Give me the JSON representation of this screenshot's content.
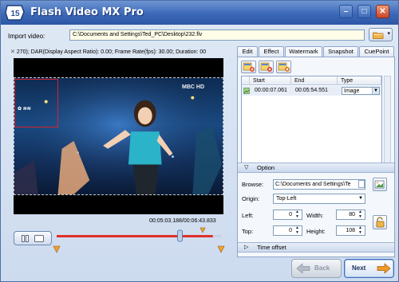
{
  "window": {
    "title": "Flash Video MX Pro",
    "logo_text": "15",
    "controls": [
      "minimize",
      "maximize",
      "close"
    ]
  },
  "import": {
    "label": "Import video:",
    "path": "C:\\Documents and Settings\\Ted_PC\\Desktop\\232.flv"
  },
  "video": {
    "info": "270); DAR(Display Aspect Ratio): 0.00; Frame Rate(fps): 30.00; Duration: 00",
    "channel_logo": "MBC HD",
    "time": "00:05:03.188/00:06:43.833",
    "playhead_fraction": 0.75,
    "selection_start_fraction": 0.0,
    "selection_end_fraction": 0.95
  },
  "tabs": [
    {
      "label": "Edit"
    },
    {
      "label": "Effect"
    },
    {
      "label": "Watermark",
      "active": true
    },
    {
      "label": "Snapshot"
    },
    {
      "label": "CuePoint"
    }
  ],
  "watermark": {
    "toolbar": [
      "add-watermark",
      "delete-watermark",
      "edit-watermark"
    ],
    "columns": [
      "Start",
      "End",
      "Type"
    ],
    "rows": [
      {
        "start": "00:00:07.061",
        "end": "00:05:54.551",
        "type": "Image"
      }
    ]
  },
  "option": {
    "section_label": "Option",
    "browse_label": "Browse:",
    "browse_path": "C:\\Documents and Settings\\Te",
    "origin_label": "Origin:",
    "origin_value": "Top-Left",
    "left_label": "Left:",
    "left_value": "0",
    "width_label": "Width:",
    "width_value": "80",
    "top_label": "Top:",
    "top_value": "0",
    "height_label": "Height:",
    "height_value": "108"
  },
  "time_offset": {
    "section_label": "Time offset"
  },
  "nav": {
    "back_label": "Back",
    "next_label": "Next"
  }
}
